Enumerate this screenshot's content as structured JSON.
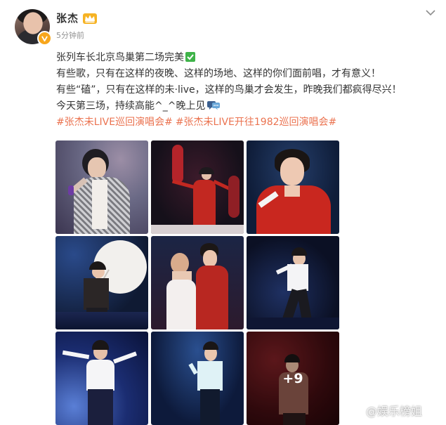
{
  "user": {
    "name": "张杰",
    "time": "5分钟前"
  },
  "post": {
    "line1": "张列车长北京鸟巢第二场完美",
    "line2": "有些歌，只有在这样的夜晚、这样的场地、这样的你们面前唱，才有意义！",
    "line3": "有些“磕”，只有在这样的未·live，这样的鸟巢才会发生，昨晚我们都疯得尽兴！",
    "line4": "今天第三场，持续高能^_^晚上见",
    "tags": [
      "#张杰未LIVE巡回演唱会#",
      "#张杰未LIVE开往1982巡回演唱会#"
    ]
  },
  "gallery": {
    "more_count": "+9",
    "count_shown": 9
  },
  "watermark": "@娱乐榜姐",
  "colors": {
    "tag": "#eb7350",
    "verified": "#f7a61c",
    "check": "#3fb349"
  },
  "icons": [
    "chevron-down-icon",
    "crown-badge-icon",
    "verified-icon",
    "check-mark-icon",
    "speech-bubble-icon"
  ]
}
